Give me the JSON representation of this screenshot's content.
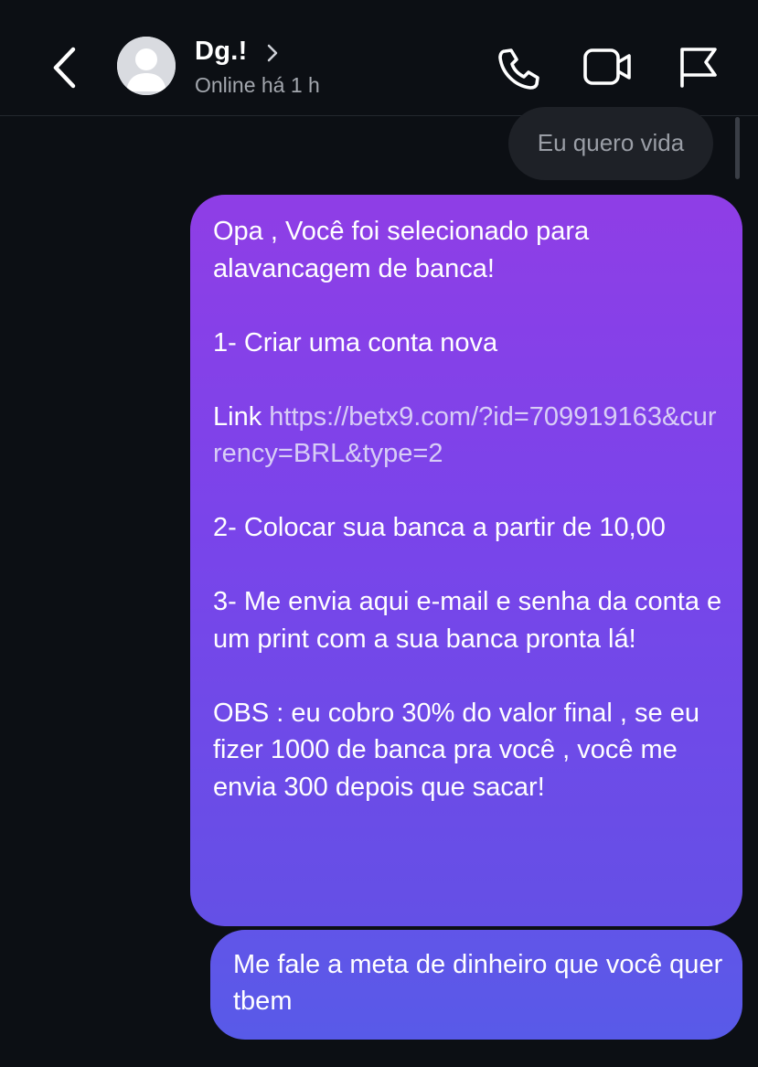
{
  "header": {
    "contact_name": "Dg.!",
    "status": "Online há 1 h",
    "icons": {
      "back": "chevron-left-icon",
      "avatar": "default-avatar-icon",
      "name_chevron": "chevron-right-icon",
      "call": "phone-icon",
      "video": "video-camera-icon",
      "report": "flag-icon"
    }
  },
  "messages": {
    "received_1": "Eu quero vida",
    "sent_1": {
      "p1": "Opa , Você foi selecionado para alavancagem de banca!",
      "p2": "1- Criar uma conta nova",
      "p3_prefix": "Link ",
      "p3_link": "https://betx9.com/?id=709919163&currency=BRL&type=2",
      "p4": "2- Colocar sua banca a partir de 10,00",
      "p5": "3- Me envia aqui e-mail e senha da conta e um print com a sua banca pronta lá!",
      "p6": "OBS : eu cobro 30% do valor final , se eu fizer 1000 de banca pra você , você me envia 300 depois que sacar!"
    },
    "sent_2": "Me fale a meta de dinheiro que você quer tbem"
  },
  "colors": {
    "background": "#0c0f14",
    "received_bubble": "#1e2127",
    "sent_gradient_top": "#8f3ee6",
    "sent_gradient_bottom": "#585ae8",
    "link": "#d8cdf6"
  }
}
